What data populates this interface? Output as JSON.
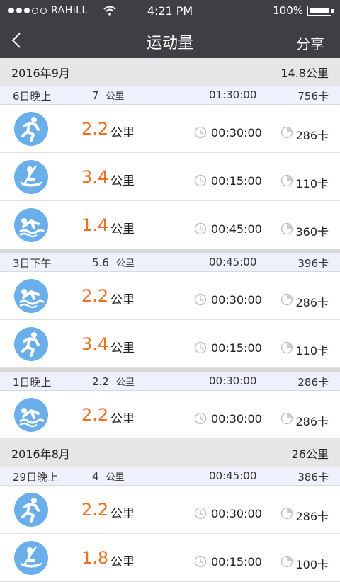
{
  "status_bar": {
    "carrier": "RAHiLL",
    "time": "4:21 PM",
    "battery": "100%"
  },
  "nav": {
    "title": "运动量",
    "share_label": "分享"
  },
  "colors": {
    "header_bg": "#3f3f43",
    "accent_orange": "#ee7022",
    "icon_blue": "#6aaeea"
  },
  "months": [
    {
      "label": "2016年9月",
      "total": "14.8公里",
      "days": [
        {
          "label": "6日晚上",
          "distance": "7",
          "unit": "公里",
          "duration": "01:30:00",
          "calories": "756卡",
          "activities": [
            {
              "icon": "running-icon",
              "distance": "2.2",
              "unit": "公里",
              "duration": "00:30:00",
              "calories": "286卡"
            },
            {
              "icon": "rowing-icon",
              "distance": "3.4",
              "unit": "公里",
              "duration": "00:15:00",
              "calories": "110卡"
            },
            {
              "icon": "swimming-icon",
              "distance": "1.4",
              "unit": "公里",
              "duration": "00:45:00",
              "calories": "360卡"
            }
          ]
        },
        {
          "label": "3日下午",
          "distance": "5.6",
          "unit": "公里",
          "duration": "00:45:00",
          "calories": "396卡",
          "activities": [
            {
              "icon": "swimming-icon",
              "distance": "2.2",
              "unit": "公里",
              "duration": "00:30:00",
              "calories": "286卡"
            },
            {
              "icon": "running-icon",
              "distance": "3.4",
              "unit": "公里",
              "duration": "00:15:00",
              "calories": "110卡"
            }
          ]
        },
        {
          "label": "1日晚上",
          "distance": "2.2",
          "unit": "公里",
          "duration": "00:30:00",
          "calories": "286卡",
          "activities": [
            {
              "icon": "swimming-icon",
              "distance": "2.2",
              "unit": "公里",
              "duration": "00:30:00",
              "calories": "286卡"
            }
          ]
        }
      ]
    },
    {
      "label": "2016年8月",
      "total": "26公里",
      "days": [
        {
          "label": "29日晚上",
          "distance": "4",
          "unit": "公里",
          "duration": "00:45:00",
          "calories": "386卡",
          "activities": [
            {
              "icon": "running-icon",
              "distance": "2.2",
              "unit": "公里",
              "duration": "00:30:00",
              "calories": "286卡"
            },
            {
              "icon": "rowing-icon",
              "distance": "1.8",
              "unit": "公里",
              "duration": "00:15:00",
              "calories": "100卡"
            }
          ]
        }
      ]
    }
  ]
}
